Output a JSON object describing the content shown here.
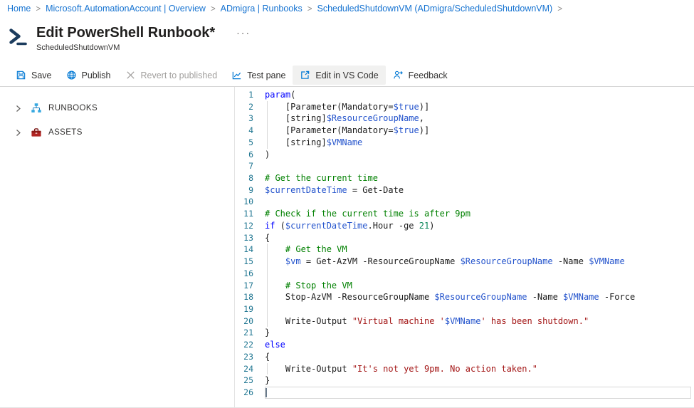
{
  "breadcrumb": {
    "separator": ">",
    "items": [
      "Home",
      "Microsoft.AutomationAccount | Overview",
      "ADmigra | Runbooks",
      "ScheduledShutdownVM (ADmigra/ScheduledShutdownVM)"
    ]
  },
  "header": {
    "title": "Edit PowerShell Runbook*",
    "subtitle": "ScheduledShutdownVM",
    "more_label": "···"
  },
  "toolbar": {
    "buttons": [
      {
        "label": "Save",
        "icon": "save-icon",
        "state": "normal"
      },
      {
        "label": "Publish",
        "icon": "publish-icon",
        "state": "normal"
      },
      {
        "label": "Revert to published",
        "icon": "revert-icon",
        "state": "disabled"
      },
      {
        "label": "Test pane",
        "icon": "test-pane-icon",
        "state": "normal"
      },
      {
        "label": "Edit in VS Code",
        "icon": "vs-code-icon",
        "state": "active"
      },
      {
        "label": "Feedback",
        "icon": "feedback-icon",
        "state": "normal"
      }
    ]
  },
  "sidebar": {
    "items": [
      {
        "label": "RUNBOOKS",
        "icon": "runbooks-icon"
      },
      {
        "label": "ASSETS",
        "icon": "assets-icon"
      }
    ]
  },
  "editor": {
    "active_line": 26,
    "colors": {
      "keyword": "#0000ff",
      "variable": "#2353cc",
      "string": "#a31515",
      "comment": "#008000",
      "number": "#098658",
      "plain": "#1b1b1b",
      "line_number": "#237893"
    },
    "lines": [
      {
        "n": 1,
        "g": 0,
        "t": [
          [
            "k",
            "param"
          ],
          [
            "p",
            "("
          ]
        ]
      },
      {
        "n": 2,
        "g": 1,
        "t": [
          [
            "p",
            "    [Parameter(Mandatory="
          ],
          [
            "v",
            "$true"
          ],
          [
            "p",
            ")]"
          ]
        ]
      },
      {
        "n": 3,
        "g": 1,
        "t": [
          [
            "p",
            "    [string]"
          ],
          [
            "v",
            "$ResourceGroupName"
          ],
          [
            "p",
            ","
          ]
        ]
      },
      {
        "n": 4,
        "g": 1,
        "t": [
          [
            "p",
            "    [Parameter(Mandatory="
          ],
          [
            "v",
            "$true"
          ],
          [
            "p",
            ")]"
          ]
        ]
      },
      {
        "n": 5,
        "g": 1,
        "t": [
          [
            "p",
            "    [string]"
          ],
          [
            "v",
            "$VMName"
          ]
        ]
      },
      {
        "n": 6,
        "g": 0,
        "t": [
          [
            "p",
            ")"
          ]
        ]
      },
      {
        "n": 7,
        "g": 0,
        "t": []
      },
      {
        "n": 8,
        "g": 0,
        "t": [
          [
            "c",
            "# Get the current time"
          ]
        ]
      },
      {
        "n": 9,
        "g": 0,
        "t": [
          [
            "v",
            "$currentDateTime"
          ],
          [
            "p",
            " = Get-Date"
          ]
        ]
      },
      {
        "n": 10,
        "g": 0,
        "t": []
      },
      {
        "n": 11,
        "g": 0,
        "t": [
          [
            "c",
            "# Check if the current time is after 9pm"
          ]
        ]
      },
      {
        "n": 12,
        "g": 0,
        "t": [
          [
            "k",
            "if"
          ],
          [
            "p",
            " ("
          ],
          [
            "v",
            "$currentDateTime"
          ],
          [
            "p",
            ".Hour -ge "
          ],
          [
            "n2",
            "21"
          ],
          [
            "p",
            ")"
          ]
        ]
      },
      {
        "n": 13,
        "g": 0,
        "t": [
          [
            "p",
            "{"
          ]
        ]
      },
      {
        "n": 14,
        "g": 1,
        "t": [
          [
            "c",
            "    # Get the VM"
          ]
        ]
      },
      {
        "n": 15,
        "g": 1,
        "t": [
          [
            "p",
            "    "
          ],
          [
            "v",
            "$vm"
          ],
          [
            "p",
            " = Get-AzVM -ResourceGroupName "
          ],
          [
            "v",
            "$ResourceGroupName"
          ],
          [
            "p",
            " -Name "
          ],
          [
            "v",
            "$VMName"
          ]
        ]
      },
      {
        "n": 16,
        "g": 1,
        "t": []
      },
      {
        "n": 17,
        "g": 1,
        "t": [
          [
            "c",
            "    # Stop the VM"
          ]
        ]
      },
      {
        "n": 18,
        "g": 1,
        "t": [
          [
            "p",
            "    Stop-AzVM -ResourceGroupName "
          ],
          [
            "v",
            "$ResourceGroupName"
          ],
          [
            "p",
            " -Name "
          ],
          [
            "v",
            "$VMName"
          ],
          [
            "p",
            " -Force"
          ]
        ]
      },
      {
        "n": 19,
        "g": 1,
        "t": []
      },
      {
        "n": 20,
        "g": 1,
        "t": [
          [
            "p",
            "    Write-Output "
          ],
          [
            "s",
            "\"Virtual machine '"
          ],
          [
            "v",
            "$VMName"
          ],
          [
            "s",
            "' has been shutdown.\""
          ]
        ]
      },
      {
        "n": 21,
        "g": 0,
        "t": [
          [
            "p",
            "}"
          ]
        ]
      },
      {
        "n": 22,
        "g": 0,
        "t": [
          [
            "k",
            "else"
          ]
        ]
      },
      {
        "n": 23,
        "g": 0,
        "t": [
          [
            "p",
            "{"
          ]
        ]
      },
      {
        "n": 24,
        "g": 1,
        "t": [
          [
            "p",
            "    Write-Output "
          ],
          [
            "s",
            "\"It's not yet 9pm. No action taken.\""
          ]
        ]
      },
      {
        "n": 25,
        "g": 0,
        "t": [
          [
            "p",
            "}"
          ]
        ]
      },
      {
        "n": 26,
        "g": 0,
        "t": []
      }
    ]
  },
  "colors": {
    "accent": "#0078d4",
    "breadcrumb_link": "#1673d1",
    "toolbar_active_bg": "#f1f1f0",
    "powershell_icon": "#1c3c5e",
    "runbooks_icon_blue": "#35a8e0",
    "assets_icon_red": "#b02423"
  }
}
